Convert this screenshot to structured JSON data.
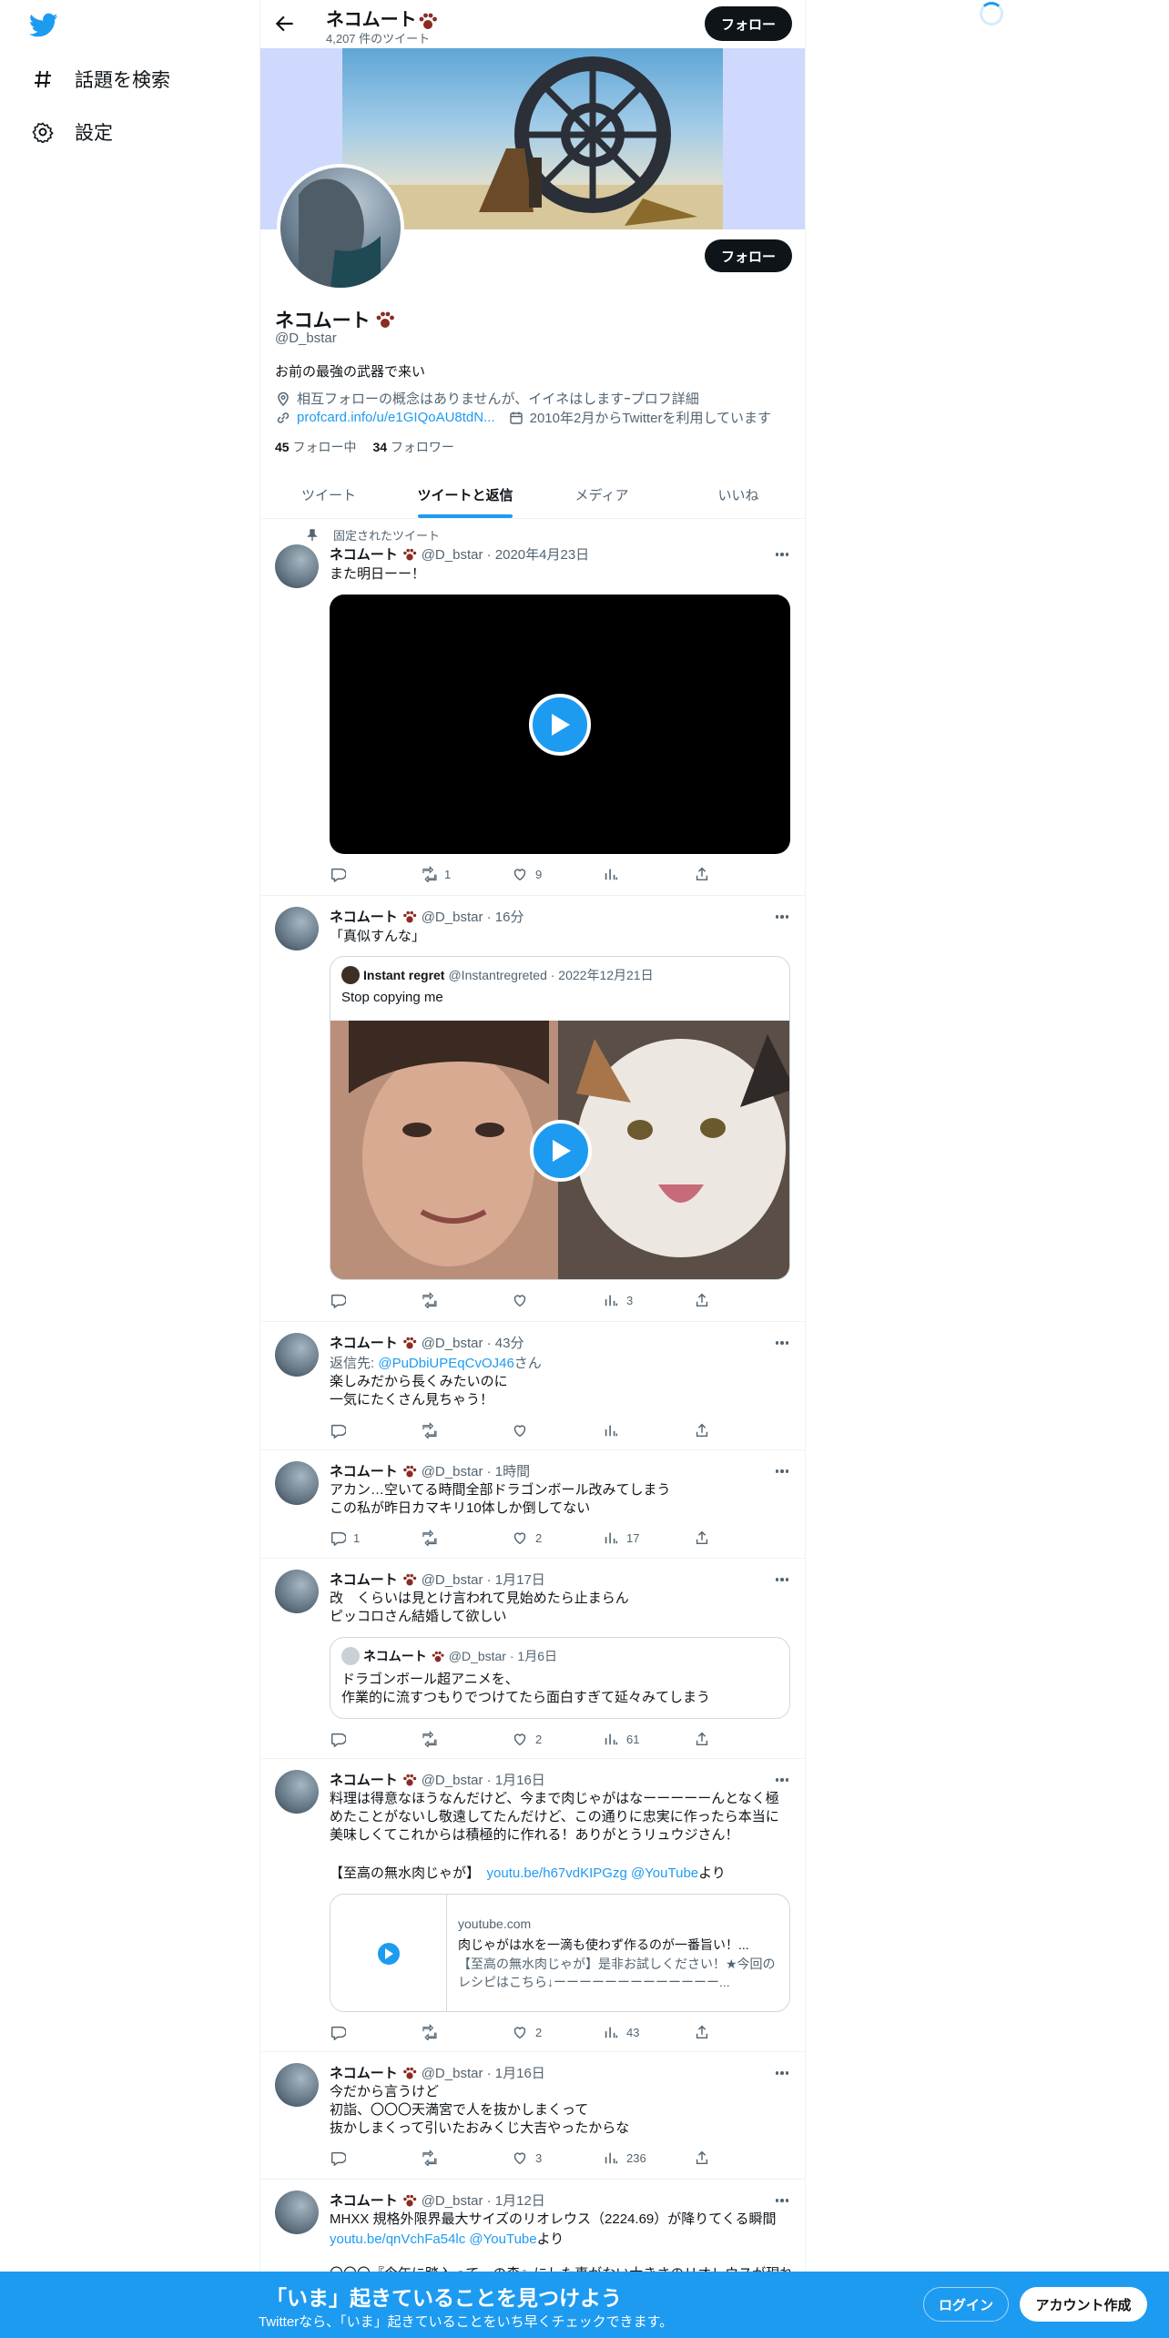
{
  "nav": {
    "explore_label": "話題を検索",
    "settings_label": "設定"
  },
  "header": {
    "name": "ネコムート",
    "tweet_count": "4,207 件のツイート",
    "follow_label": "フォロー"
  },
  "profile": {
    "name": "ネコムート",
    "handle": "@D_bstar",
    "bio": "お前の最強の武器で来い",
    "location": "相互フォローの概念はありませんが、イイネはしますｰプロフ詳細",
    "link": "profcard.info/u/e1GIQoAU8tdN...",
    "joined": "2010年2月からTwitterを利用しています",
    "following_count": "45",
    "following_label": "フォロー中",
    "followers_count": "34",
    "followers_label": "フォロワー",
    "follow_label": "フォロー"
  },
  "tabs": [
    "ツイート",
    "ツイートと返信",
    "メディア",
    "いいね"
  ],
  "tweets": [
    {
      "pinned_label": "固定されたツイート",
      "name": "ネコムート",
      "meta": "@D_bstar · 2020年4月23日",
      "text": "また明日ーー！",
      "reply": "",
      "retweet": "1",
      "like": "9",
      "views": ""
    },
    {
      "name": "ネコムート",
      "meta": "@D_bstar · 16分",
      "text": "「真似すんな」",
      "quote_name": "Instant regret",
      "quote_meta": "@Instantregreted · 2022年12月21日",
      "quote_text": "Stop copying me",
      "reply": "",
      "retweet": "",
      "like": "",
      "views": "3"
    },
    {
      "name": "ネコムート",
      "meta": "@D_bstar · 43分",
      "reply_prefix": "返信先: ",
      "reply_to": "@PuDbiUPEqCvOJ46",
      "reply_suffix": "さん",
      "text": "楽しみだから長くみたいのに\n一気にたくさん見ちゃう！",
      "reply": "",
      "retweet": "",
      "like": "",
      "views": ""
    },
    {
      "name": "ネコムート",
      "meta": "@D_bstar · 1時間",
      "text": "アカン…空いてる時間全部ドラゴンボール改みてしまう\nこの私が昨日カマキリ10体しか倒してない",
      "reply": "1",
      "retweet": "",
      "like": "2",
      "views": "17"
    },
    {
      "name": "ネコムート",
      "meta": "@D_bstar · 1月17日",
      "text": "改　くらいは見とけ言われて見始めたら止まらん\nピッコロさん結婚して欲しい",
      "quote_name": "ネコムート",
      "quote_meta": "@D_bstar · 1月6日",
      "quote_text": "ドラゴンボール超アニメを、\n作業的に流すつもりでつけてたら面白すぎて延々みてしまう",
      "reply": "",
      "retweet": "",
      "like": "2",
      "views": "61"
    },
    {
      "name": "ネコムート",
      "meta": "@D_bstar · 1月16日",
      "text": "料理は得意なほうなんだけど、今まで肉じゃがはなーーーーーんとなく極めたことがないし敬遠してたんだけど、この通りに忠実に作ったら本当に美味しくてこれからは積極的に作れる！ありがとうリュウジさん！",
      "text2_prefix": "【至高の無水肉じゃが】　",
      "text2_link": "youtu.be/h67vdKIPGzg @YouTube",
      "text2_suffix": "より",
      "card_domain": "youtube.com",
      "card_title": "肉じゃがは水を一滴も使わず作るのが一番旨い！...",
      "card_desc": "【至高の無水肉じゃが】是非お試しください！★今回のレシピはこちら↓ーーーーーーーーーーーーー...",
      "reply": "",
      "retweet": "",
      "like": "2",
      "views": "43"
    },
    {
      "name": "ネコムート",
      "meta": "@D_bstar · 1月16日",
      "text": "今だから言うけど\n初詣、〇〇〇天満宮で人を抜かしまくって\n抜かしまくって引いたおみくじ大吉やったからな",
      "reply": "",
      "retweet": "",
      "like": "3",
      "views": "236"
    },
    {
      "name": "ネコムート",
      "meta": "@D_bstar · 1月12日",
      "text": "MHXX 規格外限界最大サイズのリオレウス（2224.69）が降りてくる瞬間",
      "link_line": "youtu.be/qnVchFa54lc @YouTube",
      "link_suffix": "より",
      "text3": "〇〇〇『今年に踏入って一の森』にした事がない大きさのリオレウスが現れ"
    }
  ],
  "bottom": {
    "title": "「いま」起きていることを見つけよう",
    "subtitle": "Twitterなら、「いま」起きていることをいち早くチェックできます。",
    "login_label": "ログイン",
    "signup_label": "アカウント作成"
  }
}
